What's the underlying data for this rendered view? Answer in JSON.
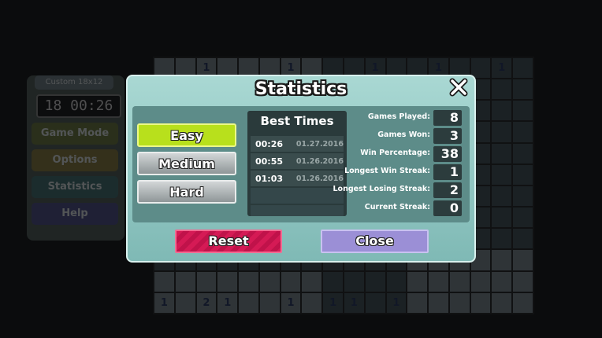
{
  "background": {
    "side_title": "Custom 18x12",
    "side_timer": "18 00:26",
    "side_buttons": [
      "Game Mode",
      "Options",
      "Statistics",
      "Help"
    ],
    "board_numbers": [
      "1",
      "1",
      "1",
      "1",
      "1",
      "1",
      "1",
      "2",
      "1",
      "2",
      "1",
      "1",
      "1",
      "1",
      "3",
      "1",
      "1"
    ]
  },
  "dialog": {
    "title": "Statistics",
    "close_icon": "close-x-icon",
    "difficulties": [
      {
        "label": "Easy",
        "selected": true
      },
      {
        "label": "Medium",
        "selected": false
      },
      {
        "label": "Hard",
        "selected": false
      }
    ],
    "best_times": {
      "title": "Best Times",
      "rows": [
        {
          "time": "00:26",
          "date": "01.27.2016"
        },
        {
          "time": "00:55",
          "date": "01.26.2016"
        },
        {
          "time": "01:03",
          "date": "01.26.2016"
        }
      ]
    },
    "stats": [
      {
        "label": "Games Played:",
        "value": "8"
      },
      {
        "label": "Games Won:",
        "value": "3"
      },
      {
        "label": "Win Percentage:",
        "value": "38"
      },
      {
        "label": "Longest Win Streak:",
        "value": "1"
      },
      {
        "label": "Longest Losing Streak:",
        "value": "2"
      },
      {
        "label": "Current Streak:",
        "value": "0"
      }
    ],
    "reset_label": "Reset",
    "close_label": "Close"
  },
  "colors": {
    "selected_difficulty": "#b8e01c",
    "reset": "#d51a55",
    "close": "#9b8fd6",
    "dialog_bg": "#a9d8d3"
  }
}
